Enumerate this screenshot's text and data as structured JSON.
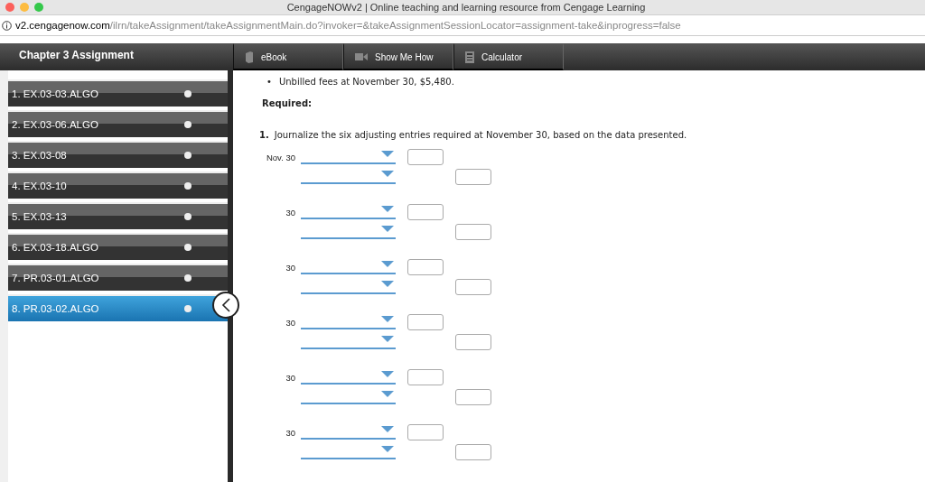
{
  "window": {
    "title": "CengageNOWv2 | Online teaching and learning resource from Cengage Learning"
  },
  "address_bar": {
    "domain": "v2.cengagenow.com",
    "path": "/ilrn/takeAssignment/takeAssignmentMain.do?invoker=&takeAssignmentSessionLocator=assignment-take&inprogress=false"
  },
  "toolbar": {
    "title": "Chapter 3 Assignment",
    "tools": [
      {
        "label": "eBook",
        "kind": "book"
      },
      {
        "label": "Show Me How",
        "kind": "video"
      },
      {
        "label": "Calculator",
        "kind": "calculator"
      }
    ]
  },
  "sidebar": {
    "items": [
      {
        "label": "1. EX.03-03.ALGO",
        "selected": false
      },
      {
        "label": "2. EX.03-06.ALGO",
        "selected": false
      },
      {
        "label": "3. EX.03-08",
        "selected": false
      },
      {
        "label": "4. EX.03-10",
        "selected": false
      },
      {
        "label": "5. EX.03-13",
        "selected": false
      },
      {
        "label": "6. EX.03-18.ALGO",
        "selected": false
      },
      {
        "label": "7. PR.03-01.ALGO",
        "selected": false
      },
      {
        "label": "8. PR.03-02.ALGO",
        "selected": true
      }
    ]
  },
  "content": {
    "bullets": [
      {
        "marker": "•",
        "text": "Unbilled fees at November 30, $5,480."
      }
    ],
    "required_heading": "Required:",
    "question_number": "1.",
    "question": "Journalize the six adjusting entries required at November 30, based on the data presented.",
    "entries": [
      {
        "date": "Nov. 30"
      },
      {
        "date": "30"
      },
      {
        "date": "30"
      },
      {
        "date": "30"
      },
      {
        "date": "30"
      },
      {
        "date": "30"
      }
    ]
  }
}
